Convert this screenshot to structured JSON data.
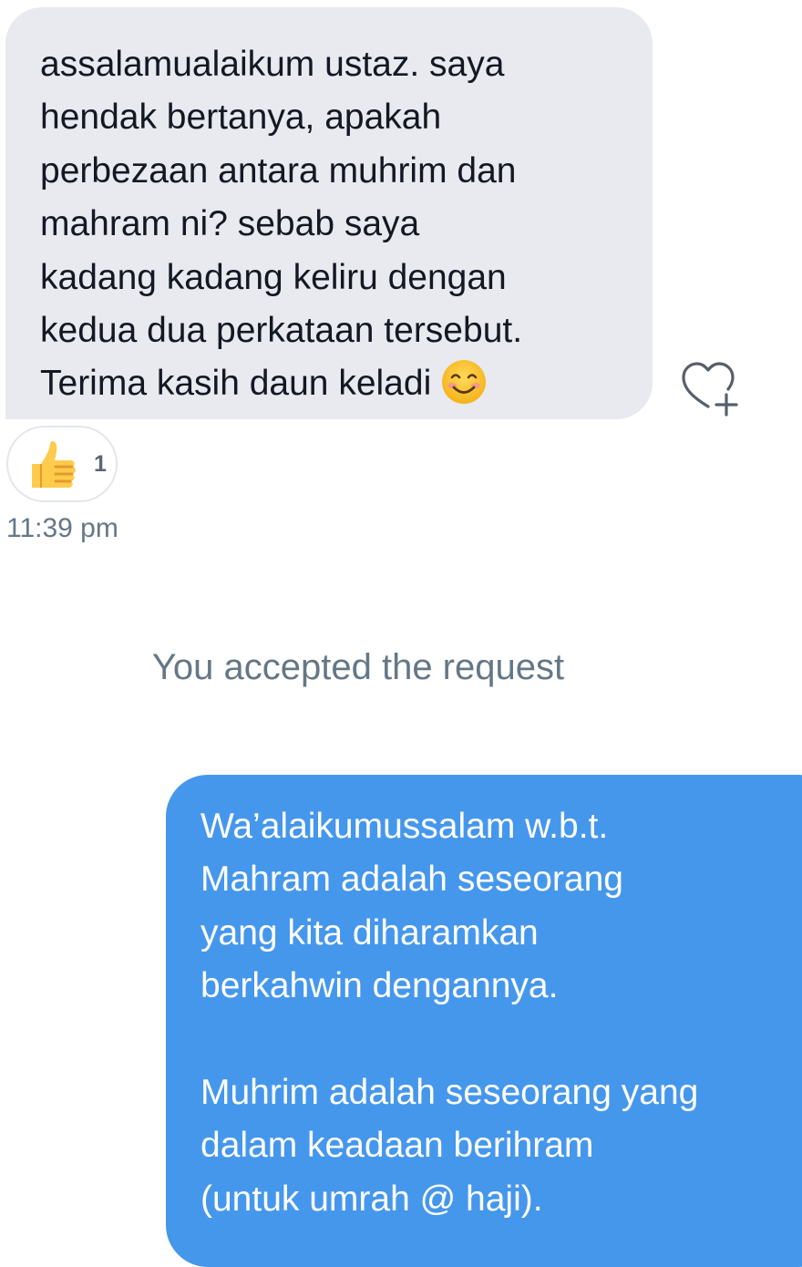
{
  "received_message": {
    "text": "assalamualaikum ustaz. saya\nhendak bertanya, apakah\nperbezaan antara muhrim dan\nmahram ni? sebab saya\nkadang kadang keliru dengan\nkedua dua perkataan tersebut.\nTerima kasih daun keladi",
    "emoji": "smiling-face-emoji",
    "reaction": {
      "emoji": "thumbs-up-emoji",
      "count": "1"
    },
    "timestamp": "11:39 pm",
    "add_reaction_icon": "heart-plus-icon"
  },
  "system_notice": "You accepted the request",
  "sent_message": {
    "text": "Wa’alaikumussalam w.b.t.\nMahram adalah seseorang\nyang kita diharamkan\nberkahwin dengannya.\n\nMuhrim adalah seseorang yang\ndalam keadaan berihram\n(untuk umrah @ haji)."
  },
  "colors": {
    "received_bubble": "#e8eaf0",
    "sent_bubble": "#4597ec",
    "secondary_text": "#657786"
  }
}
